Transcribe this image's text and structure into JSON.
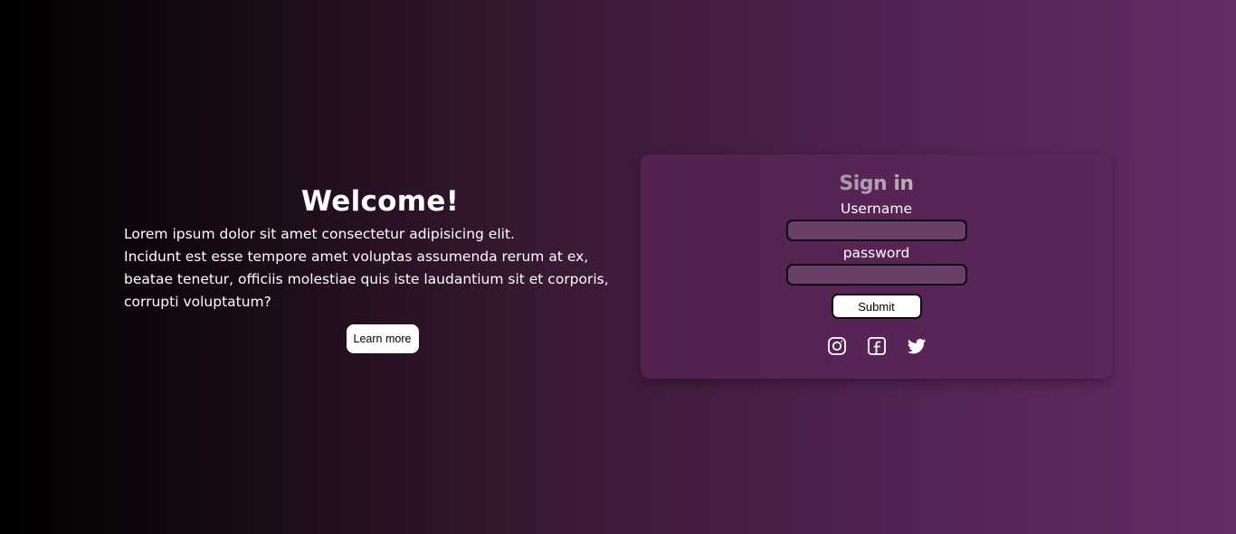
{
  "hero": {
    "title": "Welcome!",
    "body_line1": "Lorem ipsum dolor sit amet consectetur adipisicing elit.",
    "body_line2": "Incidunt est esse tempore amet voluptas assumenda rerum at ex, beatae tenetur, officiis molestiae quis iste laudantium sit et corporis, corrupti voluptatum?",
    "learn_more_label": "Learn more"
  },
  "signin": {
    "title": "Sign in",
    "username_label": "Username",
    "username_value": "",
    "password_label": "password",
    "password_value": "",
    "submit_label": "Submit"
  },
  "socials": [
    {
      "icon": "instagram-icon"
    },
    {
      "icon": "facebook-icon"
    },
    {
      "icon": "twitter-icon"
    }
  ],
  "colors": {
    "gradient_start": "#000000",
    "gradient_end": "#652c66",
    "card_bg": "#5a2658",
    "input_bg": "#6b3f6a"
  }
}
